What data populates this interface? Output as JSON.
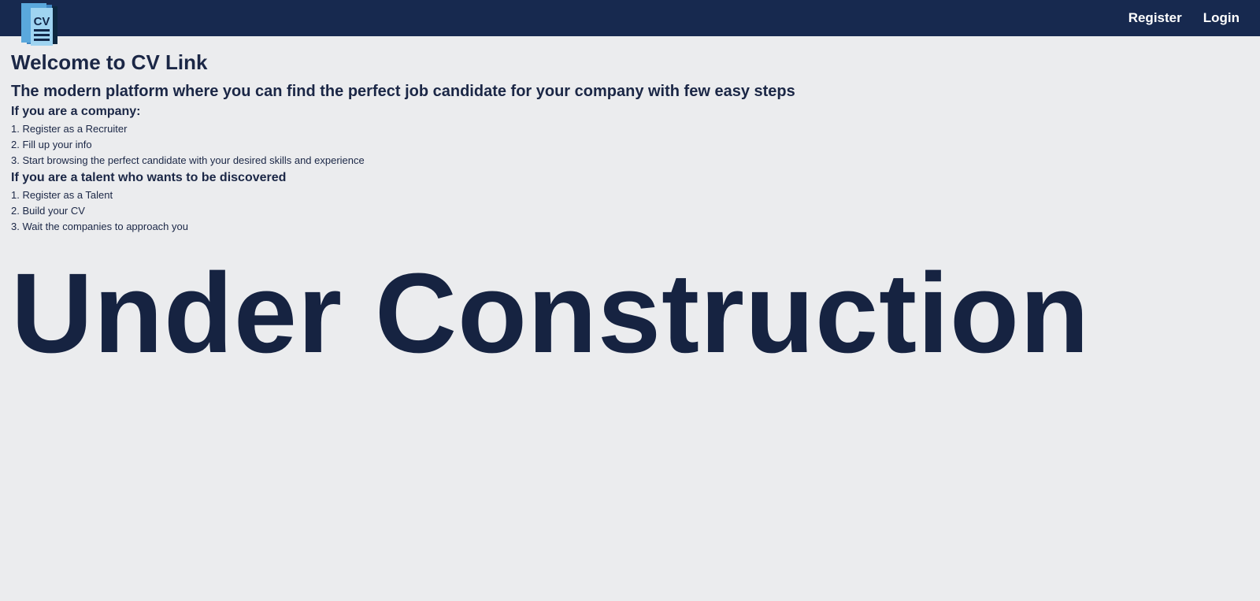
{
  "navbar": {
    "logo_text": "CV",
    "links": [
      {
        "label": "Register"
      },
      {
        "label": "Login"
      }
    ]
  },
  "main": {
    "title": "Welcome to CV Link",
    "subtitle": "The modern platform where you can find the perfect job candidate for your company with few easy steps",
    "company_section": {
      "heading": "If you are a company:",
      "steps": [
        "1. Register as a Recruiter",
        "2. Fill up your info",
        "3. Start browsing the perfect candidate with your desired skills and experience"
      ]
    },
    "talent_section": {
      "heading": "If you are a talent who wants to be discovered",
      "steps": [
        "1. Register as a Talent",
        "2. Build your CV",
        "3. Wait the companies to approach you"
      ]
    },
    "banner": "Under Construction"
  },
  "colors": {
    "navbar": "#17294f",
    "background": "#ebecee",
    "text": "#1b2746"
  },
  "icons": {
    "logo": "cv-document-icon"
  }
}
